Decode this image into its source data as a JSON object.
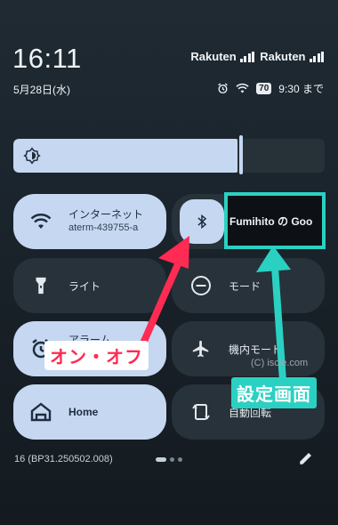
{
  "status": {
    "time": "16:11",
    "carrier1": "Rakuten",
    "carrier2": "Rakuten",
    "date": "5月28日(水)",
    "battery": "70",
    "alarm_text": "9:30 まで"
  },
  "brightness": {
    "level": 0.72
  },
  "tiles": {
    "internet_label": "インターネット",
    "internet_sub": "aterm-439755-a",
    "bluetooth_device": "Fumihito の Goo",
    "flashlight_label": "ライト",
    "mode_label": "モード",
    "alarm_label": "アラーム",
    "airplane_label": "機内モード",
    "home_label": "Home",
    "rotate_label": "自動回転"
  },
  "annotations": {
    "onoff_label": "オン・オフ",
    "settings_label": "設定画面",
    "watermark": "(C) iscle.com",
    "red_color": "#ff2b52",
    "teal_color": "#2ad1c2"
  },
  "footer": {
    "build": "16 (BP31.250502.008)"
  }
}
